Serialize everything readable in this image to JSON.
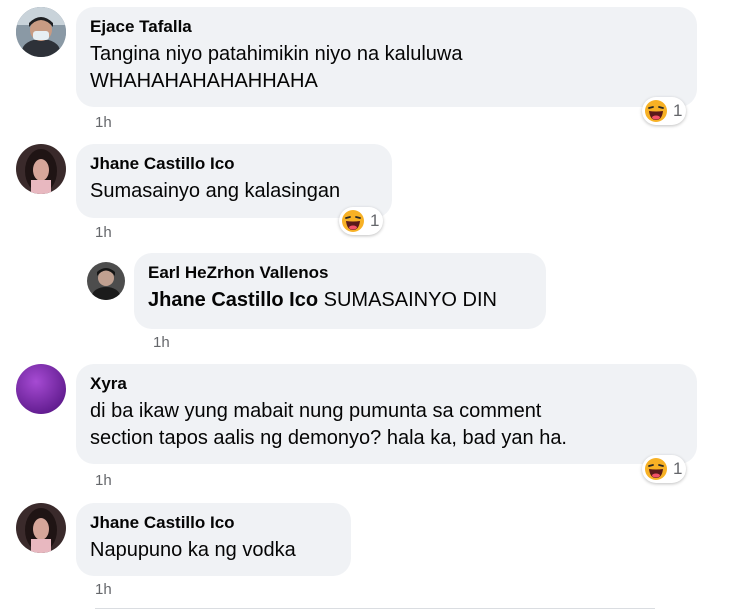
{
  "colors": {
    "bubble": "#f0f2f5",
    "meta_text": "#65676b",
    "haha_reaction": "#f7b125"
  },
  "comments": [
    {
      "author": "Ejace Tafalla",
      "text_line1": "Tangina niyo patahimikin niyo na kaluluwa",
      "text_line2": "WHAHAHAHAHAHHAHA",
      "time": "1h",
      "reaction_icon": "haha-icon",
      "reaction_count": "1"
    },
    {
      "author": "Jhane Castillo Ico",
      "text_line1": "Sumasainyo ang kalasingan",
      "time": "1h",
      "reaction_icon": "haha-icon",
      "reaction_count": "1"
    },
    {
      "author": "Earl HeZrhon Vallenos",
      "mention": "Jhane Castillo Ico",
      "text_line1": " SUMASAINYO DIN",
      "time": "1h"
    },
    {
      "author": "Xyra",
      "text_line1": "di ba ikaw yung mabait nung pumunta sa comment",
      "text_line2": "section tapos aalis ng demonyo? hala ka, bad yan ha.",
      "time": "1h",
      "reaction_icon": "haha-icon",
      "reaction_count": "1"
    },
    {
      "author": "Jhane Castillo Ico",
      "text_line1": "Napupuno ka ng vodka",
      "time": "1h"
    }
  ]
}
